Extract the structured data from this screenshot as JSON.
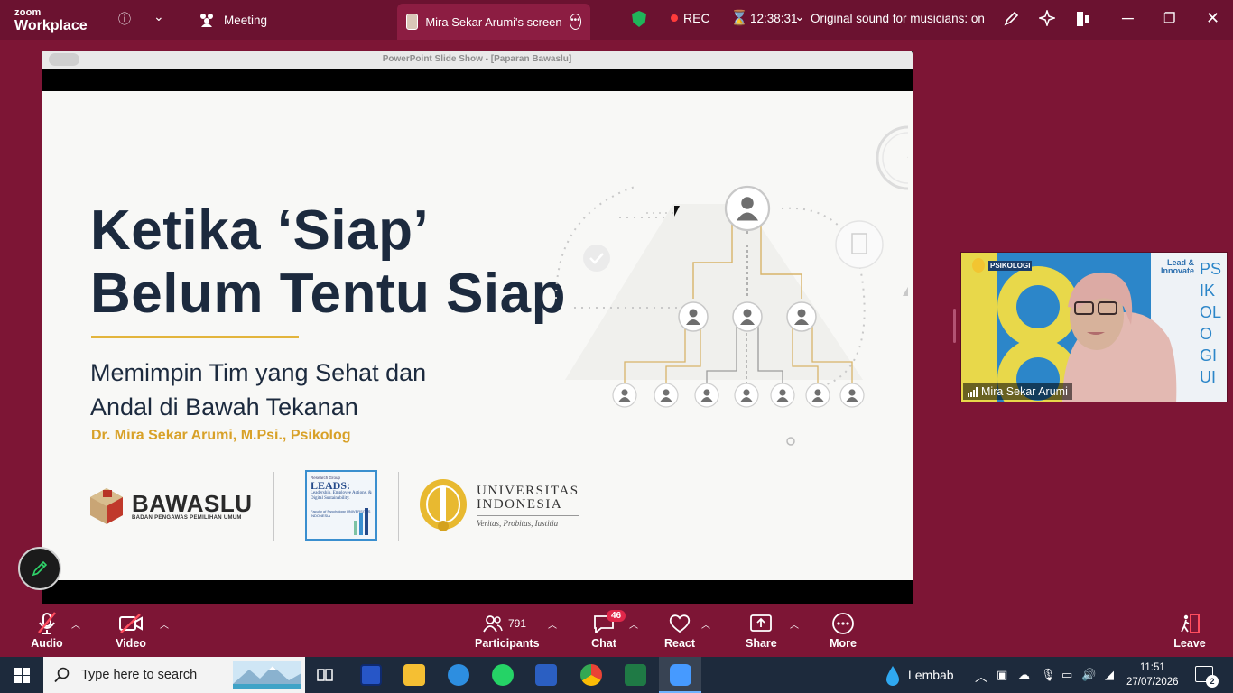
{
  "window": {
    "brand_small": "zoom",
    "brand_big": "Workplace",
    "meeting_tab": "Meeting",
    "screen_tab": "Mira Sekar Arumi's screen",
    "rec_label": "REC",
    "timer": "12:38:31",
    "audio_option": "Original sound for musicians: on"
  },
  "share": {
    "window_title": "PowerPoint Slide Show - [Paparan Bawaslu]"
  },
  "slide": {
    "title_line1": "Ketika ‘Siap’",
    "title_line2": "Belum Tentu Siap",
    "subtitle_line1": "Memimpin Tim yang Sehat dan",
    "subtitle_line2": "Andal di Bawah Tekanan",
    "author": "Dr. Mira Sekar Arumi, M.Psi., Psikolog",
    "logo_bawaslu": "BAWASLU",
    "logo_bawaslu_sub": "BADAN PENGAWAS PEMILIHAN UMUM",
    "logo_leads_top": "Research Group",
    "logo_leads_name": "LEADS:",
    "logo_leads_desc": "Leadership, Employee Actions, & Digital Sustainability.",
    "logo_leads_faculty": "Faculty of Psychology UNIVERSITAS INDONESIA",
    "logo_ui_line1": "UNIVERSITAS",
    "logo_ui_line2": "INDONESIA",
    "logo_ui_motto": "Veritas, Probitas, Iustitia"
  },
  "video": {
    "participant_name": "Mira Sekar Arumi",
    "bg_psikologi_label": "PSIKOLOGI",
    "bg_lead_label": "Lead & Innovate",
    "bg_side_text": "PSIKOLOGI UI"
  },
  "toolbar": {
    "audio": "Audio",
    "video": "Video",
    "participants": "Participants",
    "participants_count": "791",
    "chat": "Chat",
    "chat_badge": "46",
    "react": "React",
    "share": "Share",
    "more": "More",
    "leave": "Leave"
  },
  "taskbar": {
    "search_placeholder": "Type here to search",
    "weather": "Lembab",
    "time": "11:51",
    "date": "27/07/2026",
    "notifications": "2"
  }
}
